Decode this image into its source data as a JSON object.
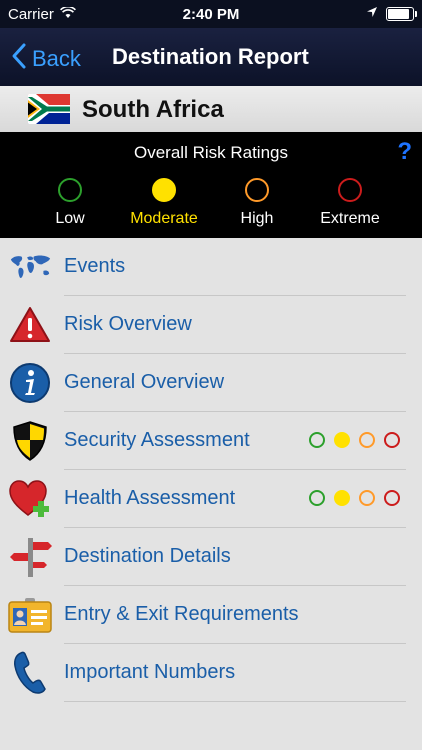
{
  "status_bar": {
    "carrier": "Carrier",
    "time": "2:40 PM",
    "battery_level": 0.9
  },
  "nav": {
    "back_label": "Back",
    "title": "Destination Report"
  },
  "country": {
    "name": "South Africa"
  },
  "risk_header": {
    "title": "Overall Risk Ratings",
    "help": "?"
  },
  "legend": [
    {
      "label": "Low",
      "color": "#2ca02c",
      "filled": false
    },
    {
      "label": "Moderate",
      "color": "#ffe100",
      "filled": true
    },
    {
      "label": "High",
      "color": "#ff9a2a",
      "filled": false
    },
    {
      "label": "Extreme",
      "color": "#cc1c1c",
      "filled": false
    }
  ],
  "menu": [
    {
      "label": "Events",
      "icon": "world-map-icon"
    },
    {
      "label": "Risk Overview",
      "icon": "warning-icon"
    },
    {
      "label": "General Overview",
      "icon": "info-icon"
    },
    {
      "label": "Security Assessment",
      "icon": "shield-icon",
      "rating": 1
    },
    {
      "label": "Health Assessment",
      "icon": "heart-plus-icon",
      "rating": 1
    },
    {
      "label": "Destination Details",
      "icon": "signpost-icon"
    },
    {
      "label": "Entry & Exit Requirements",
      "icon": "id-card-icon"
    },
    {
      "label": "Important Numbers",
      "icon": "phone-icon"
    }
  ]
}
